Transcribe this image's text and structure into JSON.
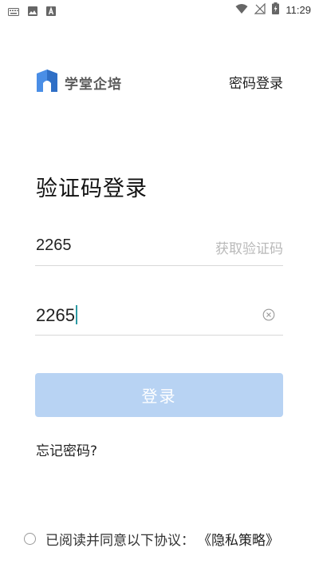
{
  "status_bar": {
    "time": "11:29",
    "left_icons": [
      "keyboard-icon",
      "image-icon",
      "text-a-icon"
    ],
    "right_icons": [
      "wifi-icon",
      "no-signal-icon",
      "battery-icon"
    ]
  },
  "header": {
    "brand_name": "学堂企培",
    "password_login_label": "密码登录"
  },
  "form": {
    "title": "验证码登录",
    "phone_value": "2265",
    "get_code_label": "获取验证码",
    "code_value": "2265",
    "login_label": "登录",
    "forgot_label": "忘记密码?"
  },
  "agreement": {
    "text": "已阅读并同意以下协议：",
    "policy_label": "《隐私策略》",
    "checked": false
  },
  "colors": {
    "login_button_bg": "#b8d3f3",
    "brand_blue": "#4a8ee6",
    "placeholder_gray": "#b9b9b9",
    "cursor_teal": "#2c9aa3"
  }
}
